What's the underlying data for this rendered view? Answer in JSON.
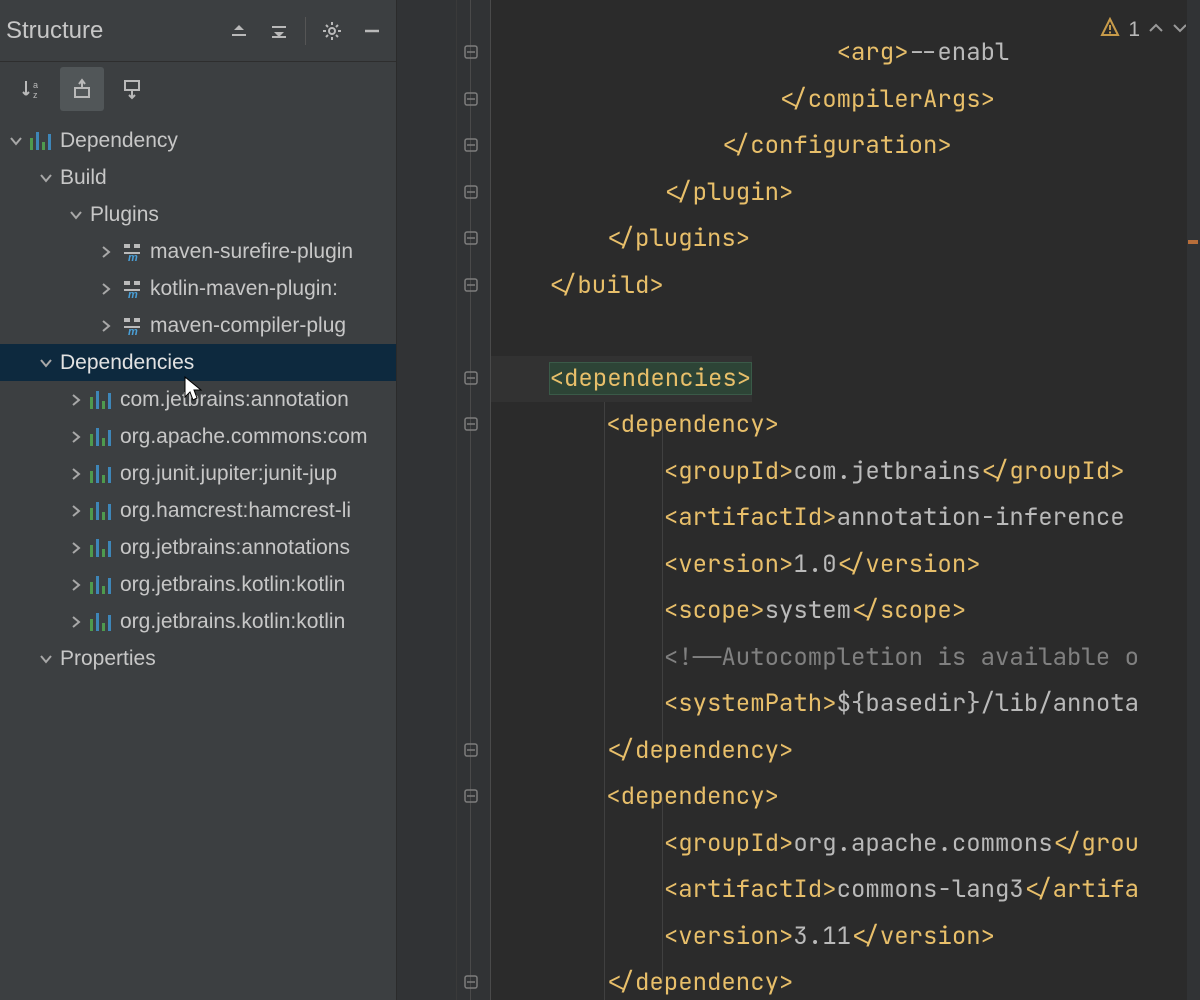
{
  "panel": {
    "title": "Structure"
  },
  "tree": {
    "root_label": "Dependency",
    "build_label": "Build",
    "plugins_label": "Plugins",
    "plugin_items": [
      "maven-surefire-plugin",
      "kotlin-maven-plugin:",
      "maven-compiler-plug"
    ],
    "deps_label": "Dependencies",
    "dep_items": [
      "com.jetbrains:annotation",
      "org.apache.commons:com",
      "org.junit.jupiter:junit-jup",
      "org.hamcrest:hamcrest-li",
      "org.jetbrains:annotations",
      "org.jetbrains.kotlin:kotlin",
      "org.jetbrains.kotlin:kotlin"
    ],
    "properties_label": "Properties"
  },
  "editor": {
    "warning_count": "1",
    "lines": [
      {
        "indent": 24,
        "open": "<arg>",
        "text": "--enabl"
      },
      {
        "indent": 20,
        "close": "</compilerArgs>"
      },
      {
        "indent": 16,
        "close": "</configuration>"
      },
      {
        "indent": 12,
        "close": "</plugin>"
      },
      {
        "indent": 8,
        "close": "</plugins>"
      },
      {
        "indent": 4,
        "close": "</build>"
      },
      {
        "blank": true
      },
      {
        "indent": 4,
        "open": "<dependencies>",
        "hl": true
      },
      {
        "indent": 8,
        "open": "<dependency>"
      },
      {
        "indent": 12,
        "open": "<groupId>",
        "text": "com.jetbrains",
        "close": "</groupId>"
      },
      {
        "indent": 12,
        "open": "<artifactId>",
        "text": "annotation-inference"
      },
      {
        "indent": 12,
        "open": "<version>",
        "text": "1.0",
        "close": "</version>"
      },
      {
        "indent": 12,
        "open": "<scope>",
        "text": "system",
        "close": "</scope>"
      },
      {
        "indent": 12,
        "comment": "<!——Autocompletion is available o"
      },
      {
        "indent": 12,
        "open": "<systemPath>",
        "text": "${basedir}/lib/annota"
      },
      {
        "indent": 8,
        "close": "</dependency>"
      },
      {
        "indent": 8,
        "open": "<dependency>"
      },
      {
        "indent": 12,
        "open": "<groupId>",
        "text": "org.apache.commons",
        "close": "</grou"
      },
      {
        "indent": 12,
        "open": "<artifactId>",
        "text": "commons-lang3",
        "close": "</artifa"
      },
      {
        "indent": 12,
        "open": "<version>",
        "text": "3.11",
        "close": "</version>"
      },
      {
        "indent": 8,
        "close": "</dependency>"
      }
    ]
  }
}
